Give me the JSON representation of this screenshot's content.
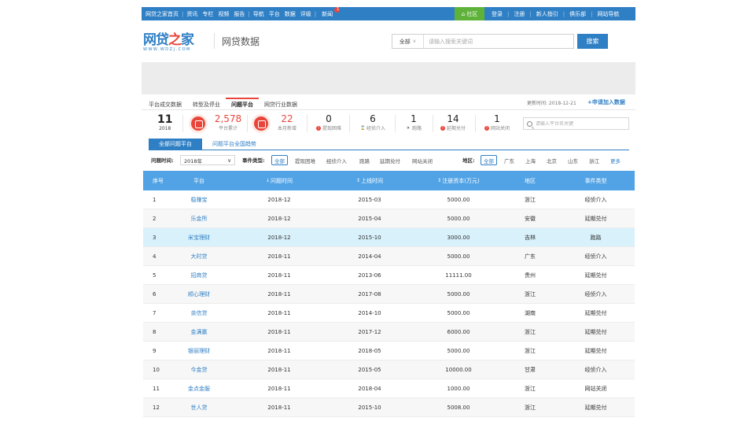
{
  "topnav": {
    "home": "网贷之家首页",
    "items": [
      "资讯",
      "专栏",
      "视频",
      "报告",
      "导航",
      "平台",
      "数据",
      "评级",
      "新闻"
    ],
    "hot_badge": "1",
    "community": "社区",
    "right_items": [
      "登录",
      "注册",
      "新人指引",
      "俱乐部",
      "网站导航"
    ]
  },
  "header": {
    "logo_text_a": "网贷",
    "logo_text_b": "之",
    "logo_text_c": "家",
    "logo_url": "WWW.WDZJ.COM",
    "section": "网贷数据",
    "search_scope": "全部",
    "search_placeholder": "请输入搜索关键词",
    "search_button": "搜索"
  },
  "tabs": [
    {
      "label": "平台成交数据"
    },
    {
      "label": "转型及停业"
    },
    {
      "label": "问题平台"
    },
    {
      "label": "网贷行业数据"
    }
  ],
  "update_text": "更新时间: 2018-12-21",
  "apply_link": "+申请加入数据",
  "stats": {
    "year_num": "11",
    "year_lbl": "2018",
    "total_num": "2,578",
    "total_lbl": "平台累计",
    "new_num": "22",
    "new_lbl": "本月新增",
    "c1_num": "0",
    "c1_lbl": "提现困难",
    "c2_num": "6",
    "c2_lbl": "经侦介入",
    "c3_num": "1",
    "c3_lbl": "跑路",
    "c4_num": "14",
    "c4_lbl": "延期兑付",
    "c5_num": "1",
    "c5_lbl": "网站关闭",
    "search_placeholder": "请输入平台名关键"
  },
  "subtabs": [
    "全部问题平台",
    "问题平台全国趋势"
  ],
  "filters": {
    "time_label": "问题时间:",
    "time_value": "2018年",
    "type_label": "事件类型:",
    "types": [
      "全部",
      "提现困难",
      "经侦介入",
      "跑路",
      "延期兑付",
      "网站关闭"
    ],
    "region_label": "地区:",
    "regions": [
      "全部",
      "广东",
      "上海",
      "北京",
      "山东",
      "浙江"
    ],
    "more": "更多"
  },
  "table": {
    "headers": {
      "idx": "序号",
      "plat": "平台",
      "prob": "问题时间",
      "online": "上线时间",
      "cap": "注册资本(万元)",
      "reg": "地区",
      "evt": "事件类型"
    },
    "rows": [
      {
        "idx": "1",
        "plat": "稳赚宝",
        "prob": "2018-12",
        "online": "2015-03",
        "cap": "5000.00",
        "reg": "浙江",
        "evt": "经侦介入"
      },
      {
        "idx": "2",
        "plat": "乐金所",
        "prob": "2018-12",
        "online": "2015-04",
        "cap": "5000.00",
        "reg": "安徽",
        "evt": "延期兑付"
      },
      {
        "idx": "3",
        "plat": "米宝理财",
        "prob": "2018-12",
        "online": "2015-10",
        "cap": "3000.00",
        "reg": "吉林",
        "evt": "跑路"
      },
      {
        "idx": "4",
        "plat": "大时贷",
        "prob": "2018-11",
        "online": "2014-04",
        "cap": "5000.00",
        "reg": "广东",
        "evt": "经侦介入"
      },
      {
        "idx": "5",
        "plat": "招商贷",
        "prob": "2018-11",
        "online": "2013-06",
        "cap": "11111.00",
        "reg": "贵州",
        "evt": "延期兑付"
      },
      {
        "idx": "6",
        "plat": "顺心理财",
        "prob": "2018-11",
        "online": "2017-08",
        "cap": "5000.00",
        "reg": "浙江",
        "evt": "经侦介入"
      },
      {
        "idx": "7",
        "plat": "余信贷",
        "prob": "2018-11",
        "online": "2014-10",
        "cap": "5000.00",
        "reg": "湖南",
        "evt": "延期兑付"
      },
      {
        "idx": "8",
        "plat": "金满赢",
        "prob": "2018-11",
        "online": "2017-12",
        "cap": "6000.00",
        "reg": "浙江",
        "evt": "延期兑付"
      },
      {
        "idx": "9",
        "plat": "银丽理财",
        "prob": "2018-11",
        "online": "2018-05",
        "cap": "5000.00",
        "reg": "浙江",
        "evt": "延期兑付"
      },
      {
        "idx": "10",
        "plat": "今金贷",
        "prob": "2018-11",
        "online": "2015-05",
        "cap": "10000.00",
        "reg": "甘肃",
        "evt": "经侦介入"
      },
      {
        "idx": "11",
        "plat": "金点金服",
        "prob": "2018-11",
        "online": "2018-04",
        "cap": "1000.00",
        "reg": "浙江",
        "evt": "网站关闭"
      },
      {
        "idx": "12",
        "plat": "世人贷",
        "prob": "2018-11",
        "online": "2015-10",
        "cap": "5008.00",
        "reg": "浙江",
        "evt": "延期兑付"
      }
    ]
  }
}
